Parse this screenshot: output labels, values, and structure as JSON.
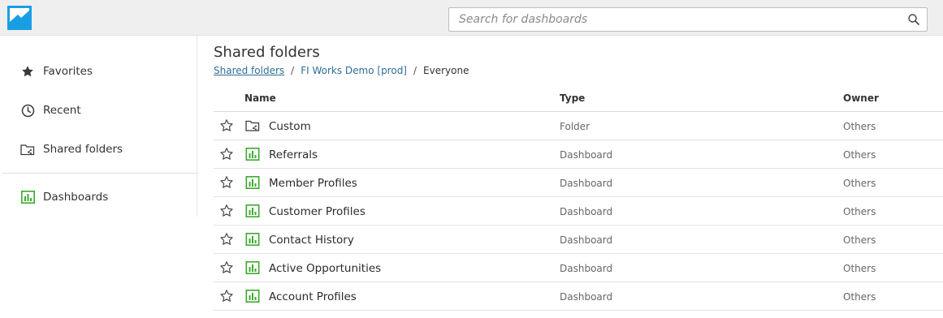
{
  "search": {
    "placeholder": "Search for dashboards"
  },
  "sidebar": {
    "items": [
      {
        "label": "Favorites",
        "icon": "star-icon"
      },
      {
        "label": "Recent",
        "icon": "clock-icon"
      },
      {
        "label": "Shared folders",
        "icon": "shared-folder-icon"
      },
      {
        "label": "Dashboards",
        "icon": "dashboard-icon"
      }
    ]
  },
  "main": {
    "title": "Shared folders",
    "breadcrumb": [
      "Shared folders",
      "FI Works Demo [prod]",
      "Everyone"
    ],
    "columns": {
      "name": "Name",
      "type": "Type",
      "owner": "Owner"
    },
    "rows": [
      {
        "name": "Custom",
        "type": "Folder",
        "owner": "Others",
        "icon": "shared-folder-icon"
      },
      {
        "name": "Referrals",
        "type": "Dashboard",
        "owner": "Others",
        "icon": "dashboard-icon"
      },
      {
        "name": "Member Profiles",
        "type": "Dashboard",
        "owner": "Others",
        "icon": "dashboard-icon"
      },
      {
        "name": "Customer Profiles",
        "type": "Dashboard",
        "owner": "Others",
        "icon": "dashboard-icon"
      },
      {
        "name": "Contact History",
        "type": "Dashboard",
        "owner": "Others",
        "icon": "dashboard-icon"
      },
      {
        "name": "Active Opportunities",
        "type": "Dashboard",
        "owner": "Others",
        "icon": "dashboard-icon"
      },
      {
        "name": "Account Profiles",
        "type": "Dashboard",
        "owner": "Others",
        "icon": "dashboard-icon"
      }
    ]
  },
  "colors": {
    "brand": "#1a9ee3",
    "dashboard_green": "#3cab2e",
    "link": "#2e6e99"
  }
}
